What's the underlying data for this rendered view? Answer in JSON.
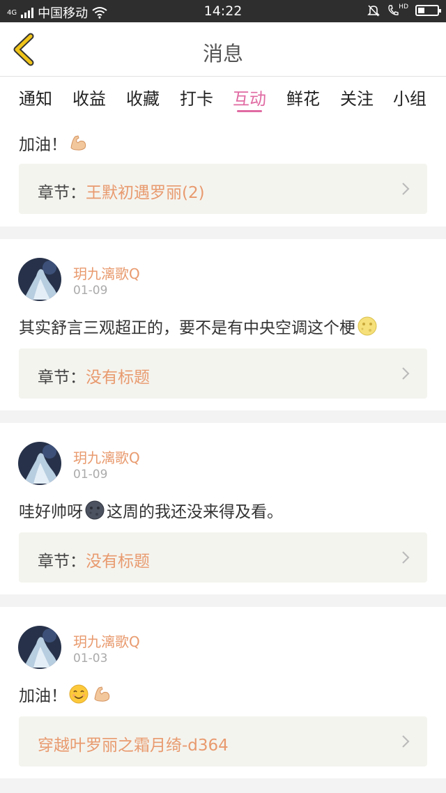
{
  "status_bar": {
    "carrier": "中国移动",
    "network": "4G",
    "time": "14:22",
    "hd_label": "HD"
  },
  "nav": {
    "title": "消息",
    "back_icon": "chevron-left-icon"
  },
  "tabs": [
    {
      "label": "通知",
      "active": false
    },
    {
      "label": "收益",
      "active": false
    },
    {
      "label": "收藏",
      "active": false
    },
    {
      "label": "打卡",
      "active": false
    },
    {
      "label": "互动",
      "active": true
    },
    {
      "label": "鲜花",
      "active": false
    },
    {
      "label": "关注",
      "active": false
    },
    {
      "label": "小组",
      "active": false
    }
  ],
  "items": [
    {
      "user": "",
      "date": "",
      "comment": "加油！",
      "emoji": [
        "flexed-biceps"
      ],
      "chapter_prefix": "章节：",
      "chapter": "王默初遇罗丽(2)"
    },
    {
      "user": "玥九漓歌Q",
      "date": "01-09",
      "comment": "其实舒言三观超正的，要不是有中央空调这个梗",
      "emoji": [
        "full-moon-face"
      ],
      "chapter_prefix": "章节：",
      "chapter": "没有标题"
    },
    {
      "user": "玥九漓歌Q",
      "date": "01-09",
      "comment": "哇好帅呀",
      "comment_after": "这周的我还没来得及看。",
      "emoji": [
        "new-moon-face"
      ],
      "chapter_prefix": "章节：",
      "chapter": "没有标题"
    },
    {
      "user": "玥九漓歌Q",
      "date": "01-03",
      "comment": "加油！",
      "emoji": [
        "smiling-face",
        "flexed-biceps"
      ],
      "chapter_prefix": "",
      "chapter": "穿越叶罗丽之霜月绮-d364"
    }
  ],
  "colors": {
    "accent": "#e06aa2",
    "name": "#e89a6e",
    "back": "#f0c419"
  }
}
